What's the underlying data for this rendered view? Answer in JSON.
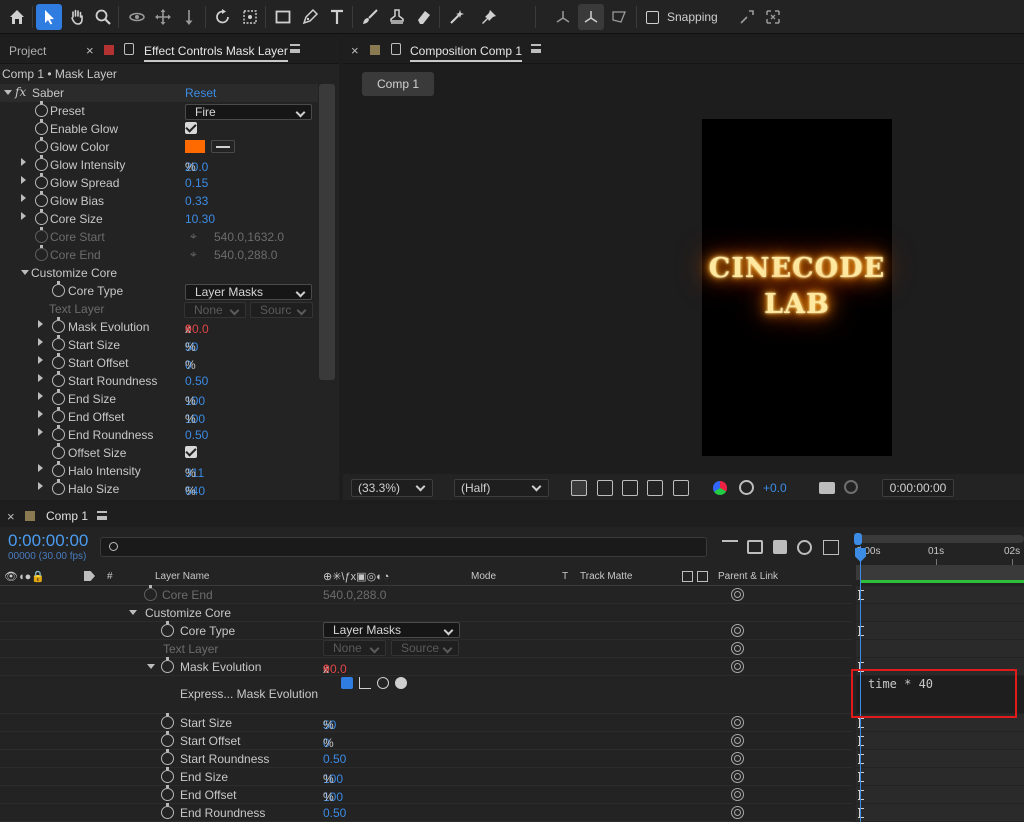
{
  "toolbar": {
    "snapping_label": "Snapping",
    "tools": [
      "home-icon",
      "selection-arrow-icon",
      "hand-icon",
      "zoom-icon",
      "orbit-camera-icon",
      "pan-camera-icon",
      "dolly-camera-icon",
      "rotate-icon",
      "pan-behind-icon",
      "rectangle-icon",
      "pen-icon",
      "type-icon",
      "brush-icon",
      "clone-stamp-icon",
      "eraser-icon",
      "roto-brush-icon",
      "puppet-pin-icon"
    ],
    "accent": "#2f7de1"
  },
  "left_panel": {
    "tab_project": "Project",
    "tab_effect": "Effect Controls Mask Layer",
    "breadcrumb": "Comp 1 • Mask Layer",
    "effect_name": "Saber",
    "reset": "Reset",
    "fx": "fx",
    "rows": {
      "preset": {
        "label": "Preset",
        "value": "Fire"
      },
      "enable_glow": {
        "label": "Enable Glow"
      },
      "glow_color": {
        "label": "Glow Color",
        "color": "#ff6a00"
      },
      "glow_intensity": {
        "label": "Glow Intensity",
        "value": "20.0",
        "unit": "%"
      },
      "glow_spread": {
        "label": "Glow Spread",
        "value": "0.15"
      },
      "glow_bias": {
        "label": "Glow Bias",
        "value": "0.33"
      },
      "core_size": {
        "label": "Core Size",
        "value": "10.30"
      },
      "core_start": {
        "label": "Core Start",
        "value": "540.0,1632.0"
      },
      "core_end": {
        "label": "Core End",
        "value": "540.0,288.0"
      },
      "customize_core": {
        "label": "Customize Core"
      },
      "core_type": {
        "label": "Core Type",
        "value": "Layer Masks"
      },
      "text_layer": {
        "label": "Text Layer",
        "value": "None",
        "value2": "Sourc"
      },
      "mask_evolution": {
        "label": "Mask Evolution",
        "rev": "0",
        "x": "x",
        "deg": "+0.0",
        "unit": "°"
      },
      "start_size": {
        "label": "Start Size",
        "value": "50",
        "unit": "%"
      },
      "start_offset": {
        "label": "Start Offset",
        "value": "0",
        "unit": "%"
      },
      "start_roundness": {
        "label": "Start Roundness",
        "value": "0.50"
      },
      "end_size": {
        "label": "End Size",
        "value": "100",
        "unit": "%"
      },
      "end_offset": {
        "label": "End Offset",
        "value": "100",
        "unit": "%"
      },
      "end_roundness": {
        "label": "End Roundness",
        "value": "0.50"
      },
      "offset_size": {
        "label": "Offset Size"
      },
      "halo_intensity": {
        "label": "Halo Intensity",
        "value": "311",
        "unit": "%"
      },
      "halo_size": {
        "label": "Halo Size",
        "value": "640",
        "unit": "%"
      }
    }
  },
  "comp_panel": {
    "tab": "Composition Comp 1",
    "comp_tab": "Comp 1",
    "canvas_text_line1": "CINECODE",
    "canvas_text_line2": "LAB",
    "zoom": "(33.3%)",
    "resolution": "(Half)",
    "exposure": "+0.0",
    "timecode": "0:00:00:00"
  },
  "timeline": {
    "tab": "Comp 1",
    "timecode": "0:00:00:00",
    "frames": "00000 (30.00 fps)",
    "search_placeholder": "",
    "columns": {
      "number": "#",
      "layer_name": "Layer Name",
      "mode": "Mode",
      "t": "T",
      "track_matte": "Track Matte",
      "parent": "Parent & Link"
    },
    "ruler": [
      "0:00s",
      "01s",
      "02s"
    ],
    "rows": {
      "core_end": {
        "label": "Core End",
        "value": "540.0,288.0"
      },
      "customize_core": {
        "label": "Customize Core"
      },
      "core_type": {
        "label": "Core Type",
        "value": "Layer Masks"
      },
      "text_layer": {
        "label": "Text Layer",
        "value": "None",
        "value2": "Source"
      },
      "mask_evolution": {
        "label": "Mask Evolution",
        "rev": "0",
        "x": "x",
        "deg": "+0.0",
        "unit": "°"
      },
      "expression": {
        "label": "Express... Mask Evolution"
      },
      "start_size": {
        "label": "Start Size",
        "value": "50",
        "unit": "%"
      },
      "start_offset": {
        "label": "Start Offset",
        "value": "0",
        "unit": "%"
      },
      "start_roundness": {
        "label": "Start Roundness",
        "value": "0.50"
      },
      "end_size": {
        "label": "End Size",
        "value": "100",
        "unit": "%"
      },
      "end_offset": {
        "label": "End Offset",
        "value": "100",
        "unit": "%"
      },
      "end_roundness": {
        "label": "End Roundness",
        "value": "0.50"
      }
    },
    "expression_text": "time * 40",
    "highlight_color": "#e11a1a"
  }
}
